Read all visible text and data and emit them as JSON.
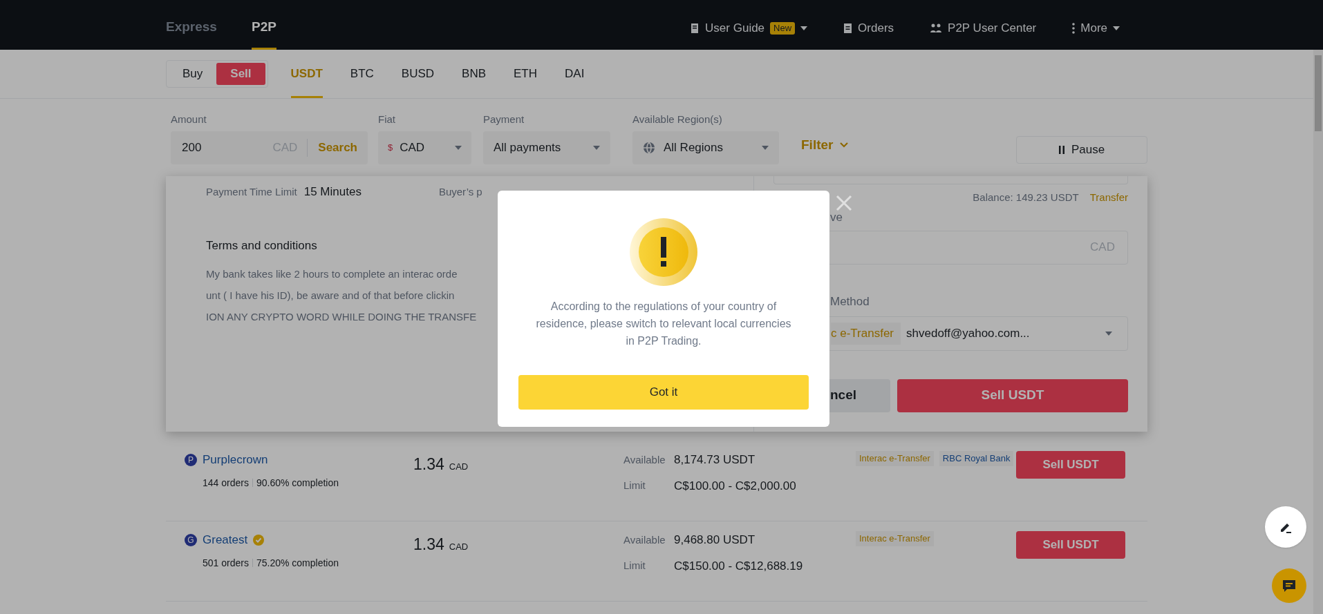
{
  "header": {
    "tabs": [
      {
        "label": "Express",
        "selected": false
      },
      {
        "label": "P2P",
        "selected": true
      }
    ],
    "nav": [
      {
        "kind": "guide",
        "label": "User Guide",
        "badge": "New"
      },
      {
        "kind": "orders",
        "label": "Orders"
      },
      {
        "kind": "center",
        "label": "P2P User Center"
      },
      {
        "kind": "more",
        "label": "More"
      }
    ]
  },
  "trade_toggle": [
    {
      "label": "Buy",
      "selected": false
    },
    {
      "label": "Sell",
      "selected": true
    }
  ],
  "assets": [
    {
      "label": "USDT",
      "selected": true
    },
    {
      "label": "BTC",
      "selected": false
    },
    {
      "label": "BUSD",
      "selected": false
    },
    {
      "label": "BNB",
      "selected": false
    },
    {
      "label": "ETH",
      "selected": false
    },
    {
      "label": "DAI",
      "selected": false
    }
  ],
  "filters": {
    "amount": {
      "label": "Amount",
      "value": "200",
      "unit": "CAD",
      "action": "Search"
    },
    "fiat": {
      "label": "Fiat",
      "symbol": "$",
      "value": "CAD"
    },
    "payment": {
      "label": "Payment",
      "value": "All payments"
    },
    "region": {
      "label": "Available Region(s)",
      "value": "All Regions"
    },
    "filter_button": "Filter",
    "pause_button": "Pause"
  },
  "expanded_ad": {
    "payment_time_limit_label": "Payment Time Limit",
    "payment_time_limit": "15 Minutes",
    "buyer_payment_label": "Buyer’s p",
    "terms_title": "Terms and conditions",
    "terms_lines": [
      "My bank takes like 2 hours to complete an interac orde",
      "unt ( I have his ID), be aware and of that before clickin",
      "ION ANY CRYPTO WORD WHILE DOING THE TRANSFE"
    ],
    "balance": "Balance: 149.23 USDT",
    "transfer_link": "Transfer",
    "receive_label": "ve",
    "receive_unit": "CAD",
    "method_label": "Method",
    "method_tag": "c e-Transfer",
    "method_account": "shvedoff@yahoo.com...",
    "cancel_button": "ncel",
    "sell_button": "Sell USDT"
  },
  "ads": [
    {
      "initial": "P",
      "name": "Purplecrown",
      "verified": false,
      "orders": "144 orders",
      "completion": "90.60% completion",
      "price": "1.34",
      "currency": "CAD",
      "available_label": "Available",
      "available": "8,174.73 USDT",
      "limit_label": "Limit",
      "limit": "C$100.00 - C$2,000.00",
      "payments": [
        {
          "label": "Interac e-Transfer",
          "kind": "transfer"
        },
        {
          "label": "RBC Royal Bank",
          "kind": "bank"
        }
      ],
      "action": "Sell USDT"
    },
    {
      "initial": "G",
      "name": "Greatest",
      "verified": true,
      "orders": "501 orders",
      "completion": "75.20% completion",
      "price": "1.34",
      "currency": "CAD",
      "available_label": "Available",
      "available": "9,468.80 USDT",
      "limit_label": "Limit",
      "limit": "C$150.00 - C$12,688.19",
      "payments": [
        {
          "label": "Interac e-Transfer",
          "kind": "transfer"
        }
      ],
      "action": "Sell USDT"
    }
  ],
  "dialog": {
    "message": "According to the regulations of your country of residence, please switch to relevant local currencies in P2P Trading.",
    "button": "Got it"
  }
}
